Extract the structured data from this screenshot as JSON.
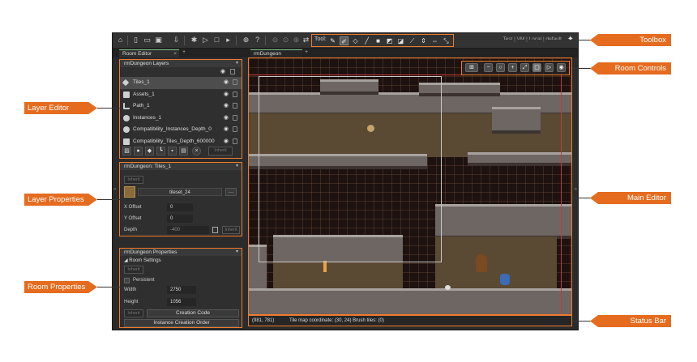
{
  "toolbar": {
    "tool_label": "Tool:",
    "config": "Test | VM | Local | default"
  },
  "tabs": {
    "left_tab": "Room Editor",
    "main_tab": "rmDungeon"
  },
  "layers_panel": {
    "title": "rmDungeon Layers",
    "layers": [
      {
        "label": "Tiles_1",
        "icon": "tile-layer-icon"
      },
      {
        "label": "Assets_1",
        "icon": "asset-layer-icon"
      },
      {
        "label": "Path_1",
        "icon": "path-layer-icon"
      },
      {
        "label": "Instances_1",
        "icon": "instance-layer-icon"
      },
      {
        "label": "Compatibility_Instances_Depth_0",
        "icon": "instance-layer-icon"
      },
      {
        "label": "Compatibility_Tiles_Depth_600000",
        "icon": "asset-layer-icon"
      }
    ],
    "inherit": "Inherit"
  },
  "layer_properties": {
    "title": "rmDungeon: Tiles_1",
    "inherit": "Inherit",
    "tileset": "tileset_24",
    "x_offset_label": "X Offset",
    "x_offset": "0",
    "y_offset_label": "Y Offset",
    "y_offset": "0",
    "depth_label": "Depth",
    "depth": "-400"
  },
  "room_properties": {
    "title": "rmDungeon Properties",
    "section": "Room Settings",
    "inherit": "Inherit",
    "persistent": "Persistent",
    "width_label": "Width",
    "width": "2750",
    "height_label": "Height",
    "height": "1056",
    "creation_code": "Creation Code",
    "instance_order": "Instance Creation Order"
  },
  "status": {
    "coords": "(981, 781)",
    "info": "Tile map coordinate: (30, 24) Brush tiles: (0)"
  },
  "callouts": {
    "layer_editor": "Layer Editor",
    "layer_properties": "Layer Properties",
    "room_properties": "Room Properties",
    "toolbox": "Toolbox",
    "room_controls": "Room Controls",
    "main_editor": "Main Editor",
    "status_bar": "Status Bar"
  },
  "colors": {
    "accent": "#f07b2a",
    "callout": "#e56b1f",
    "panel": "#2f2f2f"
  }
}
